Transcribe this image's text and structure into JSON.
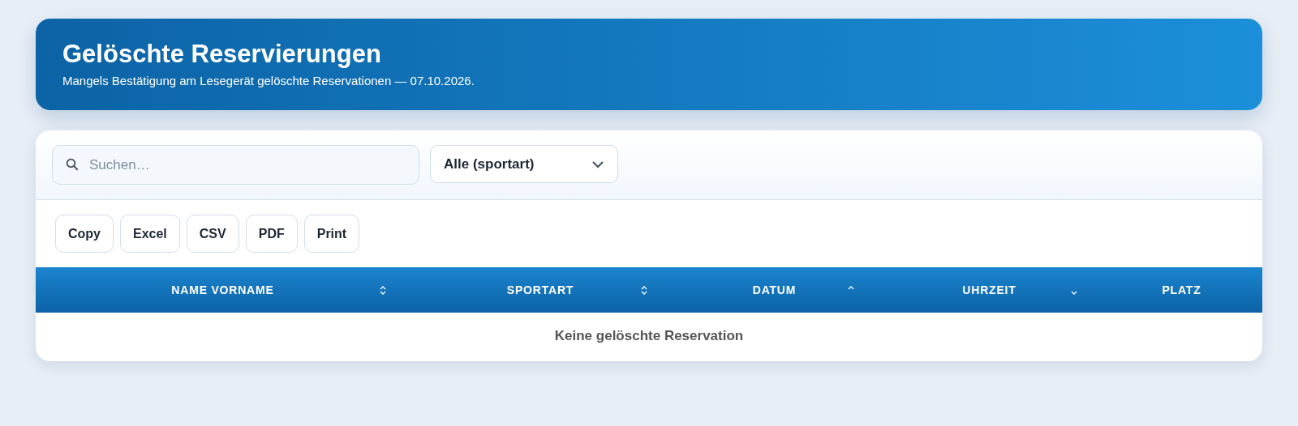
{
  "header": {
    "title": "Gelöschte Reservierungen",
    "subtitle": "Mangels Bestätigung am Lesegerät gelöschte Reservationen — 07.10.2026."
  },
  "search": {
    "placeholder": "Suchen…"
  },
  "filter": {
    "value": "Alle (sportart)"
  },
  "buttons": [
    "Copy",
    "Excel",
    "CSV",
    "PDF",
    "Print"
  ],
  "table": {
    "columns": [
      {
        "label": "NAME VORNAME",
        "sortable": true,
        "sorted_ascending": false,
        "sorted_descending": false
      },
      {
        "label": "SPORTART",
        "sortable": true,
        "sorted_ascending": false,
        "sorted_descending": false
      },
      {
        "label": "DATUM",
        "sortable": true,
        "sorted_ascending": true,
        "sorted_descending": false
      },
      {
        "label": "UHRZEIT",
        "sortable": true,
        "sorted_ascending": false,
        "sorted_descending": true
      },
      {
        "label": "PLATZ",
        "sortable": false
      }
    ],
    "empty": "Keine gelöschte Reservation"
  }
}
